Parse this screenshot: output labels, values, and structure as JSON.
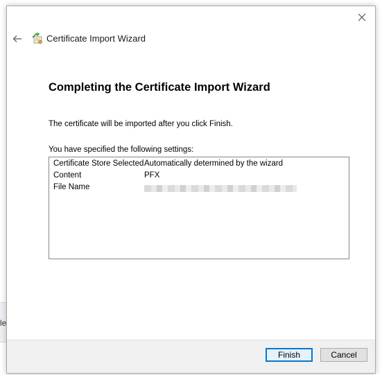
{
  "background_window": {
    "partial_text": "le"
  },
  "dialog": {
    "title": "Certificate Import Wizard",
    "heading": "Completing the Certificate Import Wizard",
    "description": "The certificate will be imported after you click Finish.",
    "settings_label": "You have specified the following settings:",
    "settings": [
      {
        "key": "Certificate Store Selected",
        "value": "Automatically determined by the wizard"
      },
      {
        "key": "Content",
        "value": "PFX"
      },
      {
        "key": "File Name",
        "value": ""
      }
    ],
    "buttons": {
      "finish": "Finish",
      "cancel": "Cancel"
    },
    "icons": {
      "close": "close-icon",
      "back": "back-arrow-icon",
      "wizard": "certificate-icon"
    },
    "colors": {
      "accent": "#0078d7",
      "border": "#828790"
    }
  }
}
